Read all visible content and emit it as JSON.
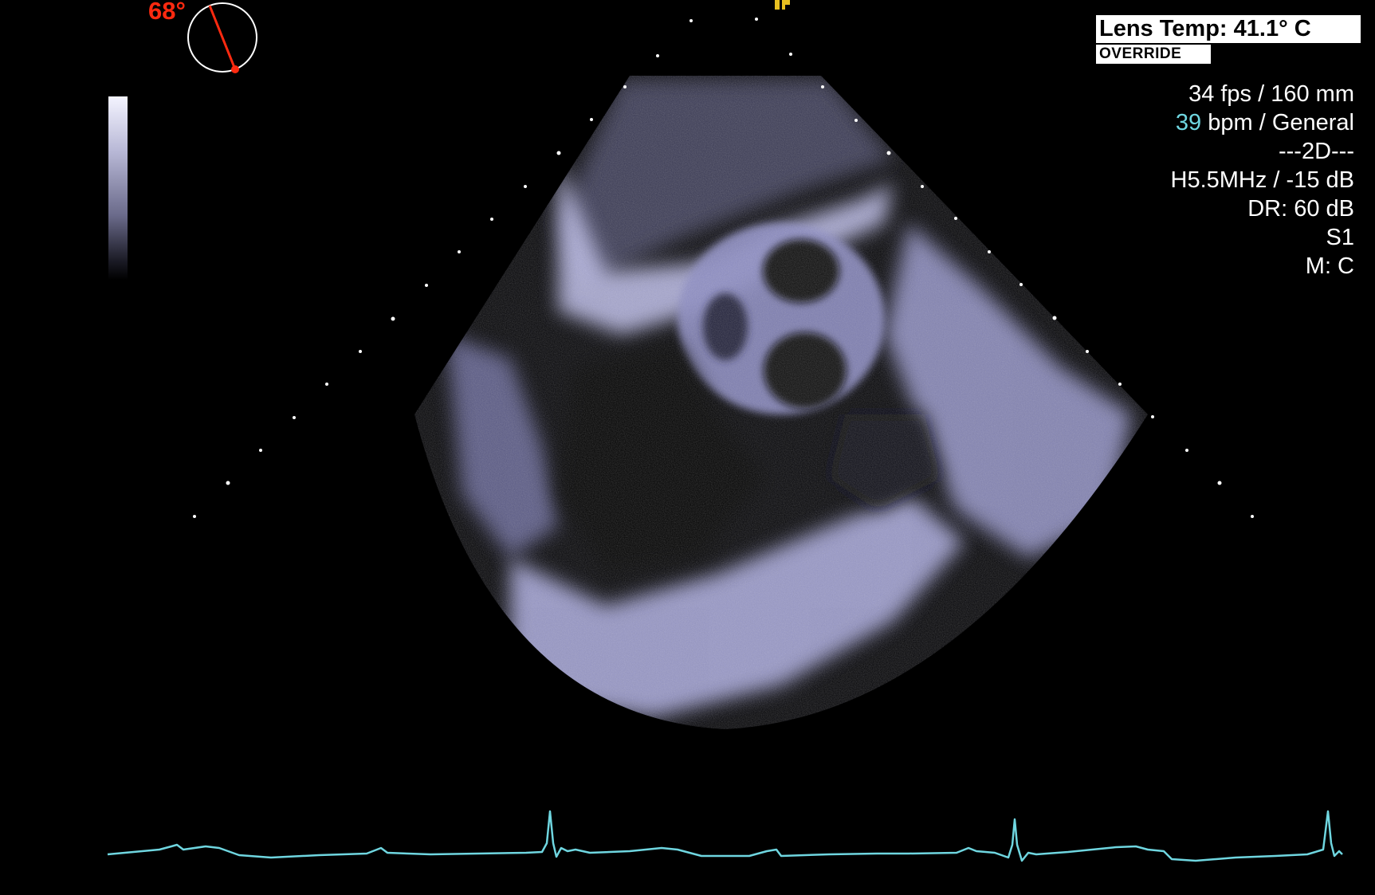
{
  "probe": {
    "angle_label": "68°",
    "angle_degrees": 68,
    "dial_color": "#ff2a10"
  },
  "header": {
    "lens_temp": "Lens Temp: 41.1° C",
    "override_label": "OVERRIDE"
  },
  "params": {
    "fps_depth": "34 fps / 160 mm",
    "bpm_value": "39",
    "bpm_suffix": " bpm / General",
    "mode": "---2D---",
    "frequency_gain": "H5.5MHz / -15 dB",
    "dynamic_range": "DR: 60 dB",
    "setting": "S1",
    "map": "M: C"
  },
  "colors": {
    "ecg_trace": "#6fd6e0",
    "background": "#000000",
    "tissue_tint": "#c8c8f0",
    "marker_yellow": "#e8c020"
  },
  "icons": {
    "angle_dial": "probe-angle-dial-icon",
    "probe_marker": "probe-orientation-marker-icon"
  }
}
